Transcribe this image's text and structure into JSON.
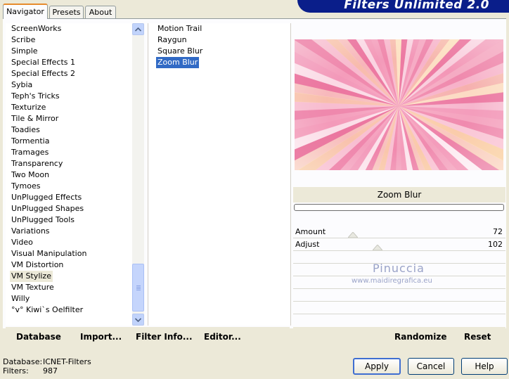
{
  "banner": {
    "title": "Filters Unlimited 2.0"
  },
  "tabs": [
    {
      "label": "Navigator",
      "active": true
    },
    {
      "label": "Presets",
      "active": false
    },
    {
      "label": "About",
      "active": false
    }
  ],
  "categories": {
    "items": [
      "ScreenWorks",
      "Scribe",
      "Simple",
      "Special Effects 1",
      "Special Effects 2",
      "Sybia",
      "Teph's Tricks",
      "Texturize",
      "Tile & Mirror",
      "Toadies",
      "Tormentia",
      "Tramages",
      "Transparency",
      "Two Moon",
      "Tymoes",
      "UnPlugged Effects",
      "UnPlugged Shapes",
      "UnPlugged Tools",
      "Variations",
      "Video",
      "Visual Manipulation",
      "VM Distortion",
      "VM Stylize",
      "VM Texture",
      "Willy",
      "°v° Kiwi`s Oelfilter"
    ],
    "selected_index": 22
  },
  "filters": {
    "items": [
      "Motion Trail",
      "Raygun",
      "Square Blur",
      "Zoom Blur"
    ],
    "selected_index": 3
  },
  "commands_left": {
    "database": "Database",
    "import": "Import...",
    "filter_info": "Filter Info...",
    "editor": "Editor..."
  },
  "commands_right": {
    "randomize": "Randomize",
    "reset": "Reset"
  },
  "preview": {
    "filter_name": "Zoom Blur",
    "progress": 0.0
  },
  "params": [
    {
      "label": "Amount",
      "value": "72",
      "max": 255
    },
    {
      "label": "Adjust",
      "value": "102",
      "max": 255
    }
  ],
  "watermark": {
    "line1": "Pinuccia",
    "line2": "www.maidiregrafica.eu"
  },
  "status": {
    "database_label": "Database:",
    "database_value": "ICNET-Filters",
    "filters_label": "Filters:",
    "filters_value": "987"
  },
  "buttons": {
    "apply": "Apply",
    "cancel": "Cancel",
    "help": "Help"
  },
  "colors": {
    "banner": "#0a1e8a",
    "selection": "#316ac5",
    "tab_accent": "#e68b2c"
  }
}
